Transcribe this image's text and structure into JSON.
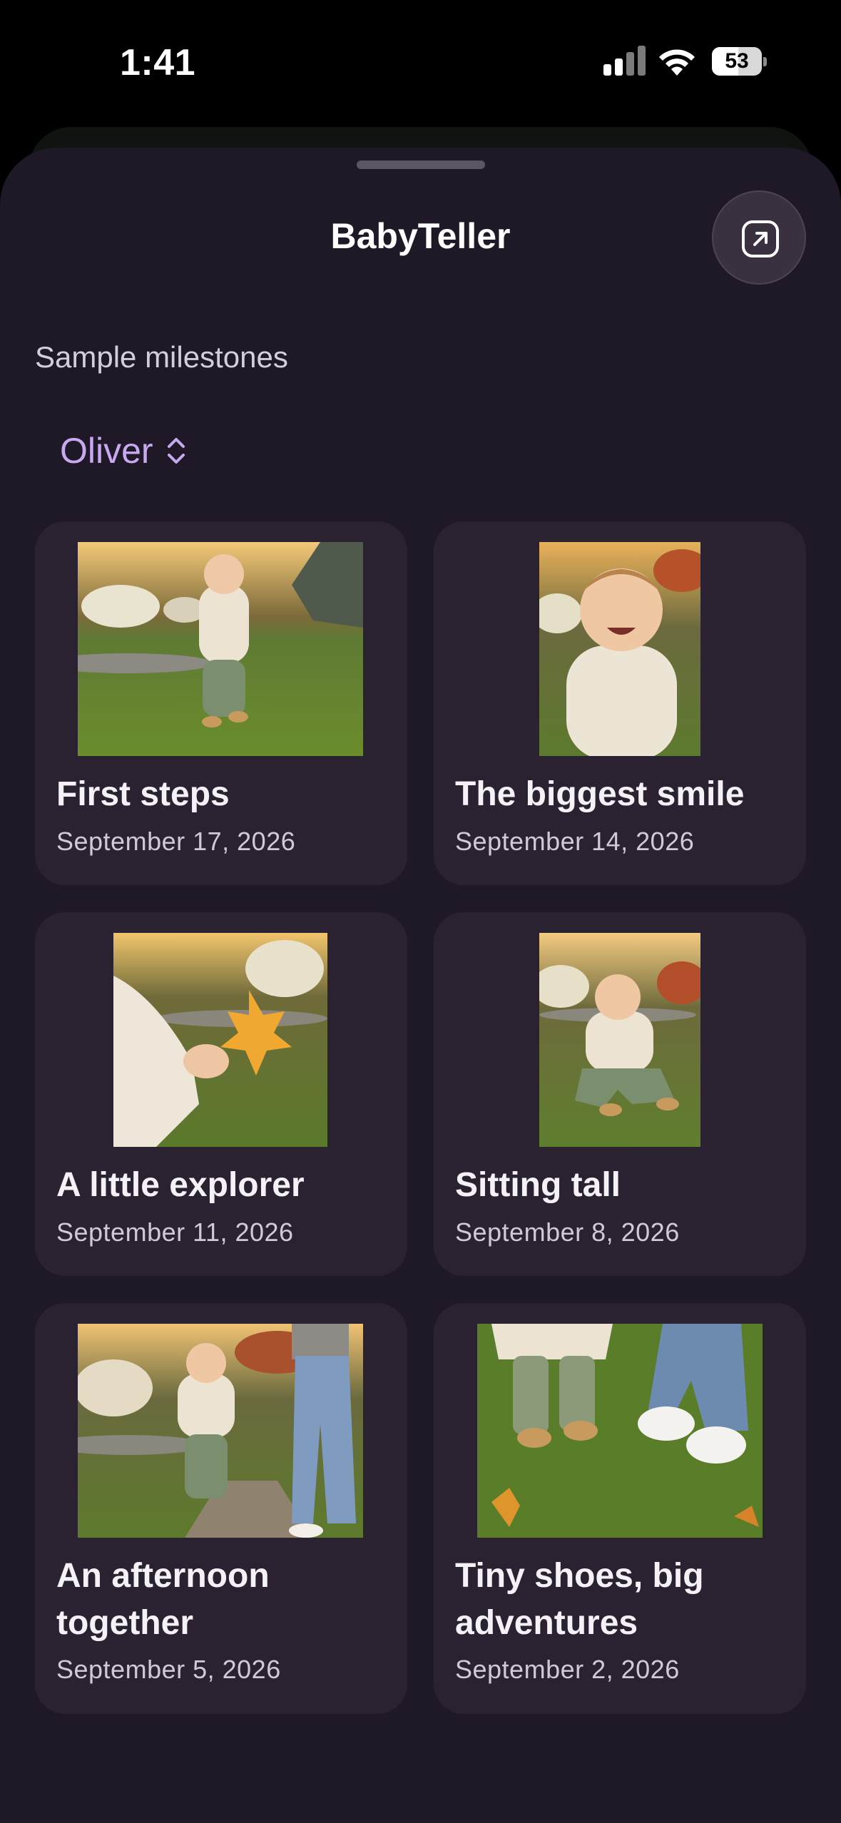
{
  "status_bar": {
    "time": "1:41",
    "battery": "53",
    "battery_level": 0.53
  },
  "app": {
    "title": "BabyTeller"
  },
  "section": {
    "label": "Sample milestones"
  },
  "child_picker": {
    "name": "Oliver"
  },
  "milestones": [
    {
      "title": "First steps",
      "date": "September 17, 2026"
    },
    {
      "title": "The biggest smile",
      "date": "September 14, 2026"
    },
    {
      "title": "A little explorer",
      "date": "September 11, 2026"
    },
    {
      "title": "Sitting tall",
      "date": "September 8, 2026"
    },
    {
      "title": "An afternoon together",
      "date": "September 5, 2026"
    },
    {
      "title": "Tiny shoes, big adventures",
      "date": "September 2, 2026"
    }
  ],
  "colors": {
    "sheet": "#1f1826",
    "card": "#2a2231",
    "accent": "#c9a8f2"
  },
  "icons": {
    "share": "arrow-up-right-square-icon",
    "picker": "chevron-up-down-icon"
  }
}
